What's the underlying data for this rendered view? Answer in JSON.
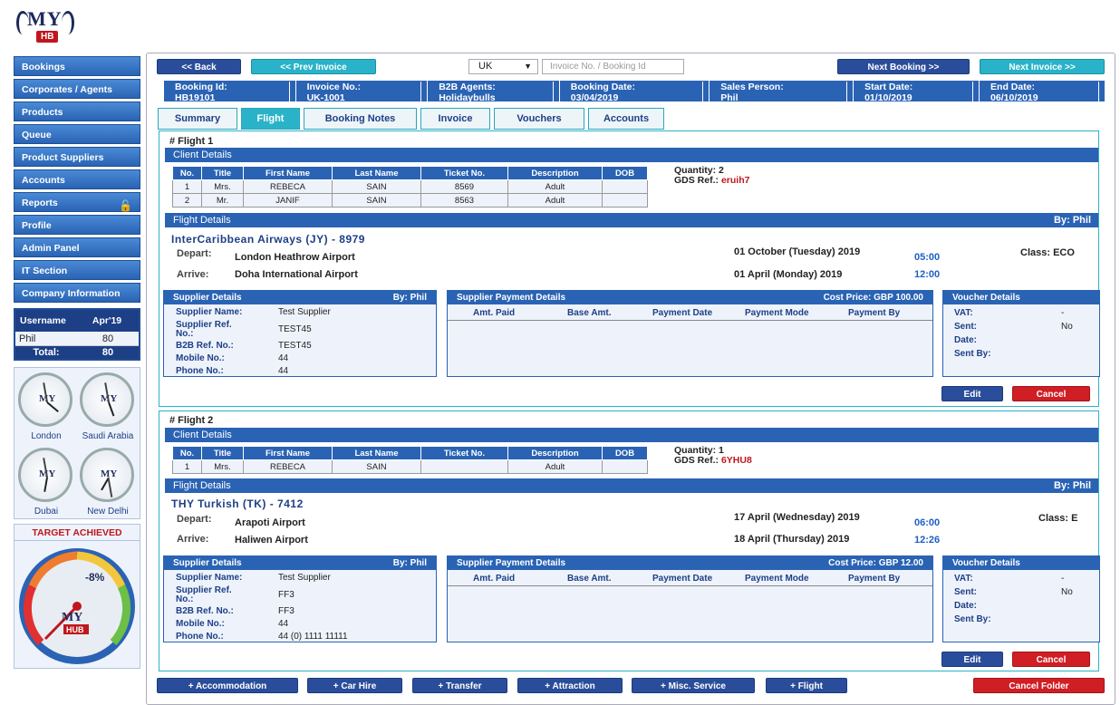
{
  "logo": {
    "my": "MY",
    "hb": "HB"
  },
  "sidebar": {
    "items": [
      {
        "label": "Bookings"
      },
      {
        "label": "Corporates / Agents"
      },
      {
        "label": "Products"
      },
      {
        "label": "Queue"
      },
      {
        "label": "Product Suppliers"
      },
      {
        "label": "Accounts"
      },
      {
        "label": "Reports"
      },
      {
        "label": "Profile"
      },
      {
        "label": "Admin Panel"
      },
      {
        "label": "IT Section"
      },
      {
        "label": "Company Information"
      }
    ]
  },
  "userbox": {
    "h1": "Username",
    "h2": "Apr'19",
    "user": "Phil",
    "value": "80",
    "total_label": "Total:",
    "total": "80"
  },
  "clocks": [
    "London",
    "Saudi Arabia",
    "Dubai",
    "New Delhi"
  ],
  "target": {
    "title": "TARGET ACHIEVED",
    "value": "-8%",
    "logo_my": "MY",
    "logo_hub": "HUB"
  },
  "toolbar": {
    "back": "<< Back",
    "prev_invoice": "<< Prev Invoice",
    "country": "UK",
    "search_placeholder": "Invoice No. / Booking Id",
    "next_booking": "Next Booking >>",
    "next_invoice": "Next Invoice >>"
  },
  "info": [
    {
      "label": "Booking Id:",
      "value": "HB19101"
    },
    {
      "label": "Invoice No.:",
      "value": "UK-1001"
    },
    {
      "label": "B2B Agents:",
      "value": "Holidaybulls"
    },
    {
      "label": "Booking Date:",
      "value": "03/04/2019"
    },
    {
      "label": "Sales Person:",
      "value": "Phil"
    },
    {
      "label": "Start Date:",
      "value": "01/10/2019"
    },
    {
      "label": "End Date:",
      "value": "06/10/2019"
    }
  ],
  "tabs": [
    "Summary",
    "Flight",
    "Booking Notes",
    "Invoice",
    "Vouchers",
    "Accounts"
  ],
  "client_headers": [
    "No.",
    "Title",
    "First Name",
    "Last Name",
    "Ticket No.",
    "Description",
    "DOB"
  ],
  "flights": [
    {
      "title": "# Flight 1",
      "client_details": "Client Details",
      "qty": "Quantity: 2",
      "gds_label": "GDS Ref.:",
      "gds": "eruih7",
      "rows": [
        [
          "1",
          "Mrs.",
          "REBECA",
          "SAIN",
          "8569",
          "Adult",
          ""
        ],
        [
          "2",
          "Mr.",
          "JANIF",
          "SAIN",
          "8563",
          "Adult",
          ""
        ]
      ],
      "flight_details": "Flight Details",
      "by": "By: Phil",
      "airline": "InterCaribbean Airways (JY) - 8979",
      "depart_label": "Depart:",
      "depart": "London Heathrow Airport",
      "depart_date": "01 October (Tuesday) 2019",
      "depart_time": "05:00",
      "class": "Class: ECO",
      "arrive_label": "Arrive:",
      "arrive": "Doha International Airport",
      "arrive_date": "01 April (Monday) 2019",
      "arrive_time": "12:00",
      "supplier": {
        "title": "Supplier Details",
        "by": "By: Phil",
        "name_l": "Supplier Name:",
        "name": "Test Supplier",
        "ref_l": "Supplier Ref. No.:",
        "ref": "TEST45",
        "b2b_l": "B2B Ref. No.:",
        "b2b": "TEST45",
        "mob_l": "Mobile No.:",
        "mob": "44",
        "ph_l": "Phone No.:",
        "ph": "44"
      },
      "payment": {
        "title": "Supplier Payment Details",
        "cost": "Cost Price: GBP 100.00",
        "cols": [
          "Amt. Paid",
          "Base Amt.",
          "Payment Date",
          "Payment Mode",
          "Payment By"
        ]
      },
      "voucher": {
        "title": "Voucher Details",
        "vat_l": "VAT:",
        "vat": "-",
        "sent_l": "Sent:",
        "sent": "No",
        "date_l": "Date:",
        "by_l": "Sent By:"
      },
      "edit": "Edit",
      "cancel": "Cancel"
    },
    {
      "title": "# Flight 2",
      "client_details": "Client Details",
      "qty": "Quantity: 1",
      "gds_label": "GDS Ref.:",
      "gds": "6YHU8",
      "rows": [
        [
          "1",
          "Mrs.",
          "REBECA",
          "SAIN",
          "",
          "Adult",
          ""
        ]
      ],
      "flight_details": "Flight Details",
      "by": "By: Phil",
      "airline": "THY Turkish (TK) - 7412",
      "depart_label": "Depart:",
      "depart": "Arapoti Airport",
      "depart_date": "17 April (Wednesday) 2019",
      "depart_time": "06:00",
      "class": "Class: E",
      "arrive_label": "Arrive:",
      "arrive": "Haliwen Airport",
      "arrive_date": "18 April (Thursday) 2019",
      "arrive_time": "12:26",
      "supplier": {
        "title": "Supplier Details",
        "by": "By: Phil",
        "name_l": "Supplier Name:",
        "name": "Test Supplier",
        "ref_l": "Supplier Ref. No.:",
        "ref": "FF3",
        "b2b_l": "B2B Ref. No.:",
        "b2b": "FF3",
        "mob_l": "Mobile No.:",
        "mob": "44",
        "ph_l": "Phone No.:",
        "ph": "44 (0) 1111 11111"
      },
      "payment": {
        "title": "Supplier Payment Details",
        "cost": "Cost Price: GBP 12.00",
        "cols": [
          "Amt. Paid",
          "Base Amt.",
          "Payment Date",
          "Payment Mode",
          "Payment By"
        ]
      },
      "voucher": {
        "title": "Voucher Details",
        "vat_l": "VAT:",
        "vat": "-",
        "sent_l": "Sent:",
        "sent": "No",
        "date_l": "Date:",
        "by_l": "Sent By:"
      },
      "edit": "Edit",
      "cancel": "Cancel"
    }
  ],
  "bottom": {
    "accommodation": "+ Accommodation",
    "car": "+ Car Hire",
    "transfer": "+ Transfer",
    "attraction": "+ Attraction",
    "misc": "+ Misc. Service",
    "flight": "+ Flight",
    "cancel_folder": "Cancel Folder"
  }
}
